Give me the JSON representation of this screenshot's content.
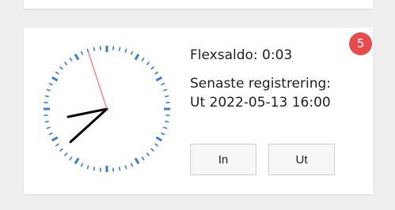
{
  "widget": {
    "flex_balance": "Flexsaldo: 0:03",
    "last_registration_label": "Senaste registrering:",
    "last_registration_value": "Ut 2022-05-13 16:00",
    "badge_count": "5",
    "in_label": "In",
    "out_label": "Ut"
  },
  "clock": {
    "hours": 8,
    "minutes": 37,
    "seconds": 57,
    "colors": {
      "tick": "#3a7bd5",
      "hand": "#000000",
      "second_hand": "#ff6b6b"
    }
  },
  "colors": {
    "badge": "#e84b4b",
    "button_bg": "#f7f7f7",
    "button_border": "#cfcfcf",
    "page_bg": "#efefef"
  }
}
